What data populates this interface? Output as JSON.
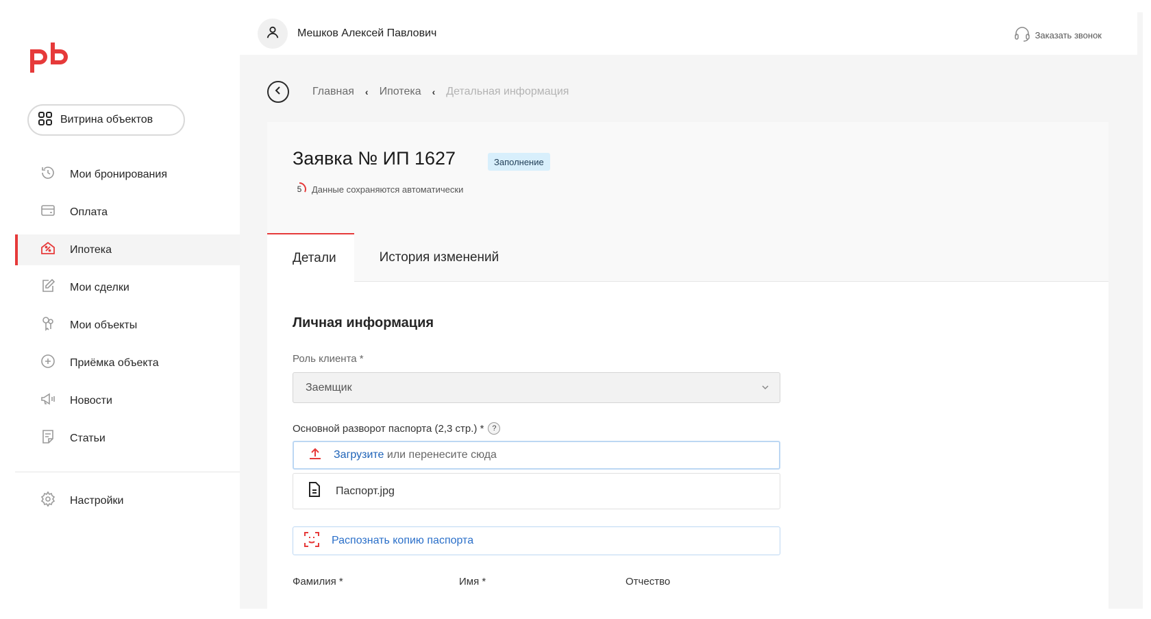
{
  "brand": {
    "logo_text": "pb",
    "accent": "#e63a3a"
  },
  "sidebar": {
    "showcase_label": "Витрина объектов",
    "items": [
      {
        "label": "Мои бронирования",
        "icon": "history-icon"
      },
      {
        "label": "Оплата",
        "icon": "card-icon"
      },
      {
        "label": "Ипотека",
        "icon": "house-percent-icon",
        "active": true
      },
      {
        "label": "Мои сделки",
        "icon": "edit-icon"
      },
      {
        "label": "Мои объекты",
        "icon": "keys-icon"
      },
      {
        "label": "Приёмка объекта",
        "icon": "plus-circle-icon"
      },
      {
        "label": "Новости",
        "icon": "megaphone-icon"
      },
      {
        "label": "Статьи",
        "icon": "article-icon"
      }
    ],
    "settings_label": "Настройки"
  },
  "header": {
    "user_name": "Мешков Алексей Павлович",
    "callback_label": "Заказать звонок"
  },
  "breadcrumbs": [
    "Главная",
    "Ипотека",
    "Детальная информация"
  ],
  "application": {
    "title": "Заявка № ИП 1627",
    "status": "Заполнение",
    "autosave_counter": "5",
    "autosave_text": "Данные сохраняются автоматически"
  },
  "tabs": [
    "Детали",
    "История изменений"
  ],
  "form": {
    "section_title": "Личная информация",
    "role_label": "Роль клиента *",
    "role_value": "Заемщик",
    "passport_label": "Основной разворот паспорта (2,3 стр.) *",
    "help": "?",
    "upload_link": "Загрузите",
    "upload_text": " или перенесите сюда",
    "file_name": "Паспорт.jpg",
    "recognize_label": "Распознать копию паспорта",
    "surname_label": "Фамилия *",
    "name_label": "Имя *",
    "patronymic_label": "Отчество"
  }
}
